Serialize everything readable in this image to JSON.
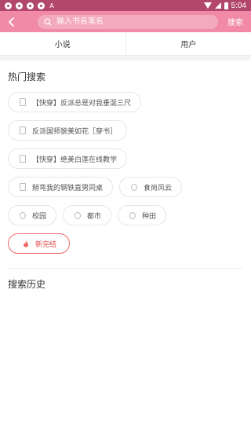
{
  "status_bar": {
    "time": "5:04"
  },
  "search": {
    "placeholder": "输入书名笔名",
    "action_label": "搜索"
  },
  "tabs": [
    {
      "label": "小说",
      "active": true
    },
    {
      "label": "用户",
      "active": false
    }
  ],
  "hot_search": {
    "title": "热门搜索",
    "chips": [
      {
        "label": "【快穿】反派总是对我垂涎三尺",
        "icon": "book-icon"
      },
      {
        "label": "反派国师貌美如花［穿书］",
        "icon": "book-icon"
      },
      {
        "label": "【快穿】绝美白莲在线教学",
        "icon": "book-icon"
      },
      {
        "label": "掰弯我的钢铁直男同桌",
        "icon": "book-icon"
      },
      {
        "label": "食尚风云",
        "icon": "tag-icon"
      },
      {
        "label": "校园",
        "icon": "tag-icon"
      },
      {
        "label": "都市",
        "icon": "tag-icon"
      },
      {
        "label": "种田",
        "icon": "tag-icon"
      },
      {
        "label": "新完结",
        "icon": "flame-icon"
      }
    ]
  },
  "history": {
    "title": "搜索历史"
  },
  "colors": {
    "status_bar": "#b2476b",
    "app_bar": "#f08aa6",
    "hot_accent": "#ef6b6b"
  }
}
